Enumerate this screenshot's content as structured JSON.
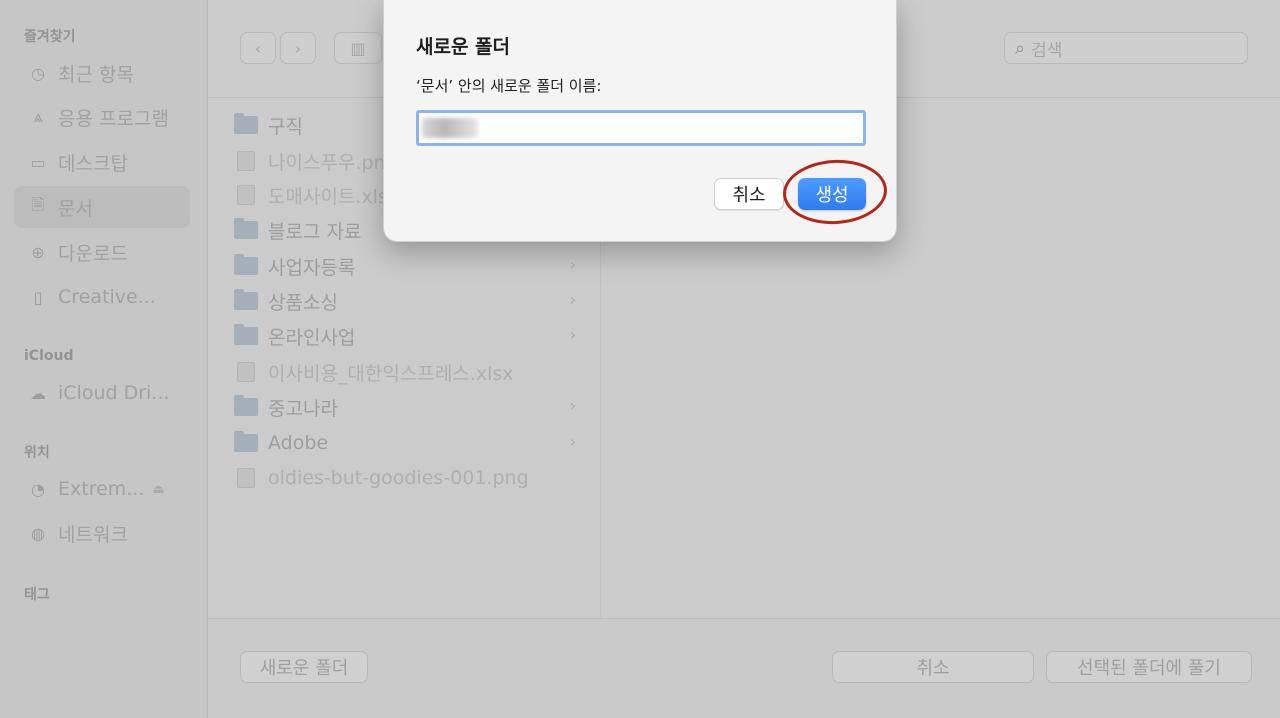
{
  "sidebar": {
    "sections": [
      {
        "label": "즐겨찾기"
      },
      {
        "label": "iCloud"
      },
      {
        "label": "위치"
      },
      {
        "label": "태그"
      }
    ],
    "items": [
      {
        "label": "최근 항목",
        "icon": "clock-icon"
      },
      {
        "label": "응용 프로그램",
        "icon": "apps-icon"
      },
      {
        "label": "데스크탑",
        "icon": "desktop-icon"
      },
      {
        "label": "문서",
        "icon": "document-icon"
      },
      {
        "label": "다운로드",
        "icon": "download-icon"
      },
      {
        "label": "Creative...",
        "icon": "file-icon"
      },
      {
        "label": "iCloud Dri...",
        "icon": "cloud-icon"
      },
      {
        "label": "Extrem...",
        "icon": "drive-icon"
      },
      {
        "label": "네트워크",
        "icon": "network-icon"
      }
    ]
  },
  "toolbar": {
    "back": "‹",
    "forward": "›",
    "view": "▥",
    "search_placeholder": "검색"
  },
  "files": [
    {
      "name": "구직",
      "type": "folder",
      "has_children": false
    },
    {
      "name": "나이스푸우.pn",
      "type": "file",
      "has_children": false
    },
    {
      "name": "도매사이트.xls",
      "type": "file",
      "has_children": false
    },
    {
      "name": "블로그 자료",
      "type": "folder",
      "has_children": false
    },
    {
      "name": "사업자등록",
      "type": "folder",
      "has_children": true
    },
    {
      "name": "상품소싱",
      "type": "folder",
      "has_children": true
    },
    {
      "name": "온라인사업",
      "type": "folder",
      "has_children": true
    },
    {
      "name": "이사비용_대한익스프레스.xlsx",
      "type": "file",
      "has_children": false
    },
    {
      "name": "중고나라",
      "type": "folder",
      "has_children": true
    },
    {
      "name": "Adobe",
      "type": "folder",
      "has_children": true
    },
    {
      "name": "oldies-but-goodies-001.png",
      "type": "file",
      "has_children": false
    }
  ],
  "bottom": {
    "new_folder": "새로운 폴더",
    "cancel": "취소",
    "extract": "선택된 폴더에 풀기"
  },
  "dialog": {
    "title": "새로운 폴더",
    "label": "‘문서’ 안의 새로운 폴더 이름:",
    "cancel": "취소",
    "create": "생성"
  },
  "colors": {
    "accent": "#2e7cf2",
    "annotation": "#b72518"
  }
}
